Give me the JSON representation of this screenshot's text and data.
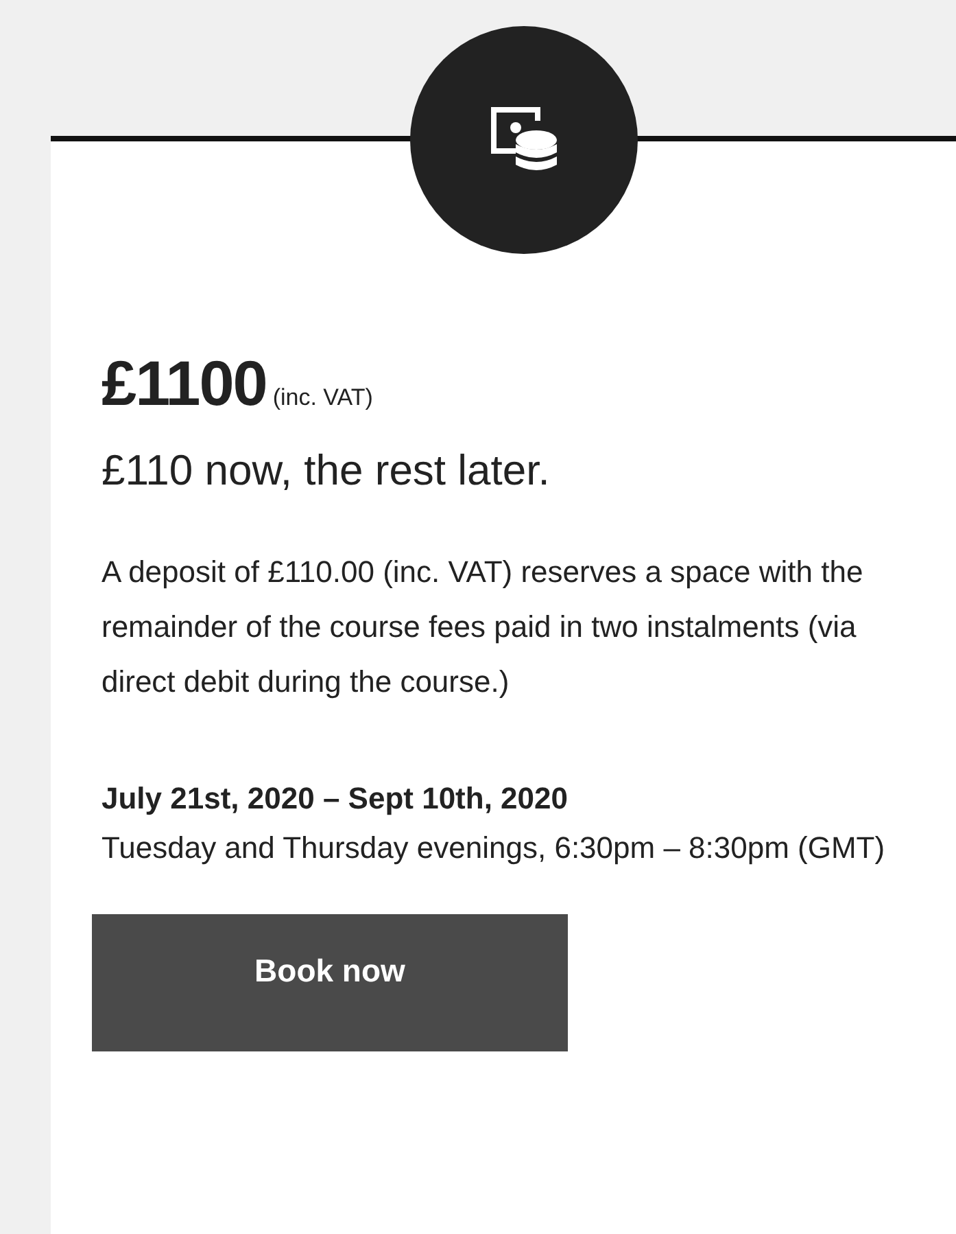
{
  "price": {
    "amount": "£1100",
    "note": "(inc. VAT)"
  },
  "deposit_summary": "£110 now, the rest later.",
  "description": "A deposit of £110.00 (inc. VAT) reserves a space with the remainder of the course fees paid in two instalments (via direct debit during the course.)",
  "dates": "July 21st, 2020 – Sept 10th, 2020",
  "schedule": "Tuesday and Thursday evenings, 6:30pm – 8:30pm (GMT)",
  "button": "Book now"
}
